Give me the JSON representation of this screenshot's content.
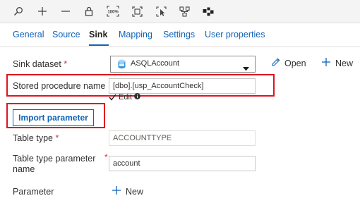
{
  "toolbar": {
    "zoom_100_label": "100%"
  },
  "tabs": [
    {
      "label": "General"
    },
    {
      "label": "Source"
    },
    {
      "label": "Sink"
    },
    {
      "label": "Mapping"
    },
    {
      "label": "Settings"
    },
    {
      "label": "User properties"
    }
  ],
  "active_tab": "Sink",
  "sink": {
    "dataset_label": "Sink dataset",
    "dataset_value": "ASQLAccount",
    "open_label": "Open",
    "new_label": "New",
    "sp_label": "Stored procedure name",
    "sp_value": "[dbo].[usp_AccountCheck]",
    "edit_label": "Edit",
    "edit_checked": true,
    "import_label": "Import parameter",
    "table_type_label": "Table type",
    "table_type_value": "ACCOUNTTYPE",
    "ttp_label_line1": "Table type parameter",
    "ttp_label_line2": "name",
    "ttp_value": "account",
    "parameter_label": "Parameter",
    "parameter_new_label": "New",
    "required_mark": "*"
  },
  "colors": {
    "accent": "#0f62b8",
    "highlight": "#e0141e",
    "required": "#d13438"
  }
}
